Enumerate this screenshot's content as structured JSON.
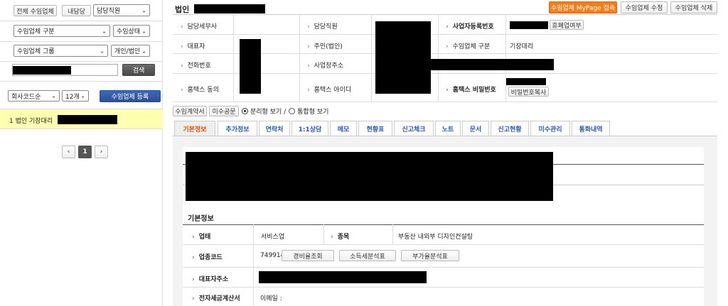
{
  "left": {
    "buttons": {
      "all": "전체 수임업체",
      "mine": "내담당"
    },
    "selects": {
      "staff": "담당직원",
      "type": "수임업체 구분",
      "status": "수임상태",
      "group": "수임업체 그룹",
      "personal": "개인/법인",
      "sort": "회사코드순",
      "count": "12개"
    },
    "search_button": "검색",
    "register_button": "수임업체 등록",
    "list": [
      {
        "text": "1 법인 기장대리"
      }
    ],
    "pager": {
      "prev": "‹",
      "current": "1",
      "next": "›"
    }
  },
  "header": {
    "title": "법인",
    "buttons": {
      "mypage": "수임업체 MyPage 접속",
      "edit": "수임업체 수정",
      "delete": "수임업체 삭제"
    },
    "colors": {
      "mypage": "#f07e1b"
    }
  },
  "info": {
    "labels": {
      "tax_agent": "담당세무사",
      "staff": "담당직원",
      "biz_no": "사업자등록번호",
      "ceo": "대표자",
      "rrn": "주민(법인)",
      "type": "수임업체 구분",
      "phone": "전화번호",
      "address": "사업장주소",
      "hometax_consent": "홈택스 동의",
      "hometax_id": "홈택스 아이디",
      "hometax_pw": "홈택스 비밀번호"
    },
    "values": {
      "type": "기장대리"
    },
    "buttons": {
      "closed_check": "휴폐업여부",
      "pw_copy": "비밀번호복사"
    }
  },
  "subbar": {
    "contract": "수임계약서",
    "unpaid": "미수공문",
    "view_split": "분리형 보기 /",
    "view_merged": "통합형 보기"
  },
  "tabs": [
    "기본정보",
    "추가정보",
    "연락처",
    "1:1상담",
    "메모",
    "현황표",
    "신고체크",
    "노트",
    "문서",
    "신고현황",
    "미수관리",
    "통화내역"
  ],
  "basic": {
    "title": "기본정보",
    "labels": {
      "business": "업태",
      "item": "종목",
      "industry_code": "업종코드",
      "ceo_address": "대표자주소",
      "einvoice": "전자세금계산서"
    },
    "values": {
      "business": "서비스업",
      "item": "부동산 내외부 디자인컨설팅",
      "industry_code": "749914",
      "email": "이메일 :"
    },
    "buttons": {
      "expense": "경비율조회",
      "income_tax": "소득세분석표",
      "vat": "부가율분석표"
    }
  }
}
